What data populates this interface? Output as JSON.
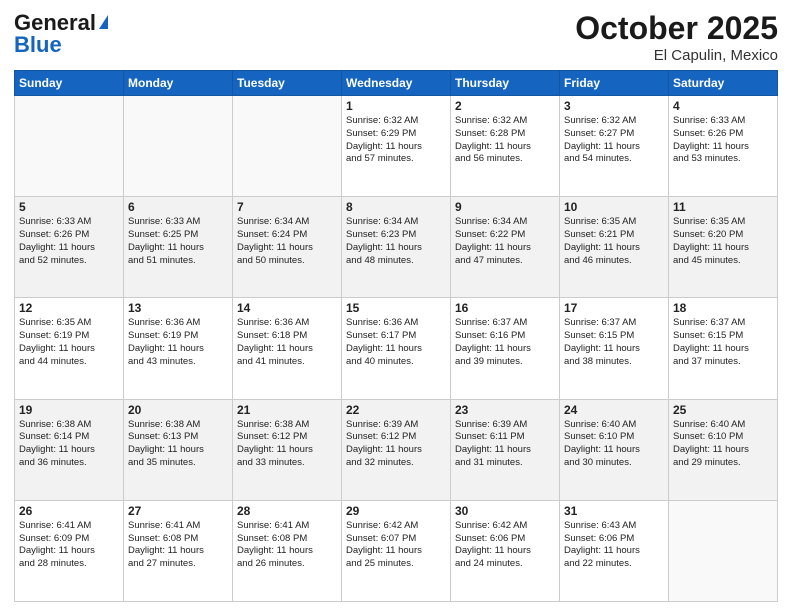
{
  "logo": {
    "line1": "General",
    "line2": "Blue"
  },
  "title": "October 2025",
  "location": "El Capulin, Mexico",
  "days_of_week": [
    "Sunday",
    "Monday",
    "Tuesday",
    "Wednesday",
    "Thursday",
    "Friday",
    "Saturday"
  ],
  "weeks": [
    [
      {
        "day": "",
        "info": ""
      },
      {
        "day": "",
        "info": ""
      },
      {
        "day": "",
        "info": ""
      },
      {
        "day": "1",
        "info": "Sunrise: 6:32 AM\nSunset: 6:29 PM\nDaylight: 11 hours\nand 57 minutes."
      },
      {
        "day": "2",
        "info": "Sunrise: 6:32 AM\nSunset: 6:28 PM\nDaylight: 11 hours\nand 56 minutes."
      },
      {
        "day": "3",
        "info": "Sunrise: 6:32 AM\nSunset: 6:27 PM\nDaylight: 11 hours\nand 54 minutes."
      },
      {
        "day": "4",
        "info": "Sunrise: 6:33 AM\nSunset: 6:26 PM\nDaylight: 11 hours\nand 53 minutes."
      }
    ],
    [
      {
        "day": "5",
        "info": "Sunrise: 6:33 AM\nSunset: 6:26 PM\nDaylight: 11 hours\nand 52 minutes."
      },
      {
        "day": "6",
        "info": "Sunrise: 6:33 AM\nSunset: 6:25 PM\nDaylight: 11 hours\nand 51 minutes."
      },
      {
        "day": "7",
        "info": "Sunrise: 6:34 AM\nSunset: 6:24 PM\nDaylight: 11 hours\nand 50 minutes."
      },
      {
        "day": "8",
        "info": "Sunrise: 6:34 AM\nSunset: 6:23 PM\nDaylight: 11 hours\nand 48 minutes."
      },
      {
        "day": "9",
        "info": "Sunrise: 6:34 AM\nSunset: 6:22 PM\nDaylight: 11 hours\nand 47 minutes."
      },
      {
        "day": "10",
        "info": "Sunrise: 6:35 AM\nSunset: 6:21 PM\nDaylight: 11 hours\nand 46 minutes."
      },
      {
        "day": "11",
        "info": "Sunrise: 6:35 AM\nSunset: 6:20 PM\nDaylight: 11 hours\nand 45 minutes."
      }
    ],
    [
      {
        "day": "12",
        "info": "Sunrise: 6:35 AM\nSunset: 6:19 PM\nDaylight: 11 hours\nand 44 minutes."
      },
      {
        "day": "13",
        "info": "Sunrise: 6:36 AM\nSunset: 6:19 PM\nDaylight: 11 hours\nand 43 minutes."
      },
      {
        "day": "14",
        "info": "Sunrise: 6:36 AM\nSunset: 6:18 PM\nDaylight: 11 hours\nand 41 minutes."
      },
      {
        "day": "15",
        "info": "Sunrise: 6:36 AM\nSunset: 6:17 PM\nDaylight: 11 hours\nand 40 minutes."
      },
      {
        "day": "16",
        "info": "Sunrise: 6:37 AM\nSunset: 6:16 PM\nDaylight: 11 hours\nand 39 minutes."
      },
      {
        "day": "17",
        "info": "Sunrise: 6:37 AM\nSunset: 6:15 PM\nDaylight: 11 hours\nand 38 minutes."
      },
      {
        "day": "18",
        "info": "Sunrise: 6:37 AM\nSunset: 6:15 PM\nDaylight: 11 hours\nand 37 minutes."
      }
    ],
    [
      {
        "day": "19",
        "info": "Sunrise: 6:38 AM\nSunset: 6:14 PM\nDaylight: 11 hours\nand 36 minutes."
      },
      {
        "day": "20",
        "info": "Sunrise: 6:38 AM\nSunset: 6:13 PM\nDaylight: 11 hours\nand 35 minutes."
      },
      {
        "day": "21",
        "info": "Sunrise: 6:38 AM\nSunset: 6:12 PM\nDaylight: 11 hours\nand 33 minutes."
      },
      {
        "day": "22",
        "info": "Sunrise: 6:39 AM\nSunset: 6:12 PM\nDaylight: 11 hours\nand 32 minutes."
      },
      {
        "day": "23",
        "info": "Sunrise: 6:39 AM\nSunset: 6:11 PM\nDaylight: 11 hours\nand 31 minutes."
      },
      {
        "day": "24",
        "info": "Sunrise: 6:40 AM\nSunset: 6:10 PM\nDaylight: 11 hours\nand 30 minutes."
      },
      {
        "day": "25",
        "info": "Sunrise: 6:40 AM\nSunset: 6:10 PM\nDaylight: 11 hours\nand 29 minutes."
      }
    ],
    [
      {
        "day": "26",
        "info": "Sunrise: 6:41 AM\nSunset: 6:09 PM\nDaylight: 11 hours\nand 28 minutes."
      },
      {
        "day": "27",
        "info": "Sunrise: 6:41 AM\nSunset: 6:08 PM\nDaylight: 11 hours\nand 27 minutes."
      },
      {
        "day": "28",
        "info": "Sunrise: 6:41 AM\nSunset: 6:08 PM\nDaylight: 11 hours\nand 26 minutes."
      },
      {
        "day": "29",
        "info": "Sunrise: 6:42 AM\nSunset: 6:07 PM\nDaylight: 11 hours\nand 25 minutes."
      },
      {
        "day": "30",
        "info": "Sunrise: 6:42 AM\nSunset: 6:06 PM\nDaylight: 11 hours\nand 24 minutes."
      },
      {
        "day": "31",
        "info": "Sunrise: 6:43 AM\nSunset: 6:06 PM\nDaylight: 11 hours\nand 22 minutes."
      },
      {
        "day": "",
        "info": ""
      }
    ]
  ]
}
